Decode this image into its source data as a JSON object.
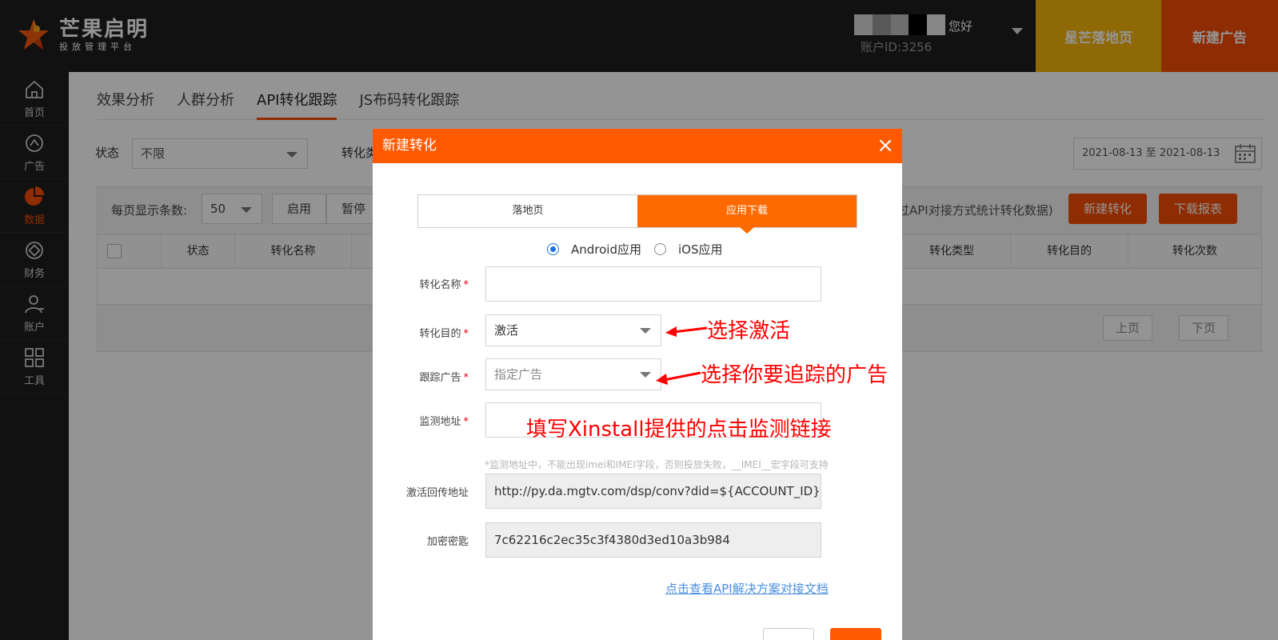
{
  "header": {
    "logo_title": "芒果启明",
    "logo_subtitle": "投放管理平台",
    "greeting": "您好",
    "account_id": "账户ID:3256",
    "btn_landing": "星芒落地页",
    "btn_new_ad": "新建广告"
  },
  "sidebar": {
    "items": [
      {
        "label": "首页",
        "icon": "home-icon"
      },
      {
        "label": "广告",
        "icon": "ad-icon"
      },
      {
        "label": "数据",
        "icon": "pie-chart-icon",
        "active": true
      },
      {
        "label": "财务",
        "icon": "finance-icon"
      },
      {
        "label": "账户",
        "icon": "user-icon"
      },
      {
        "label": "工具",
        "icon": "grid-icon"
      }
    ]
  },
  "main": {
    "tabs": [
      "效果分析",
      "人群分析",
      "API转化跟踪",
      "JS布码转化跟踪"
    ],
    "active_tab": "API转化跟踪",
    "filters": {
      "status_label": "状态",
      "status_value": "不限",
      "type_label": "转化类"
    },
    "date_range": "2021-08-13 至 2021-08-13",
    "toolbar": {
      "per_page_label": "每页显示条数:",
      "per_page_value": "50",
      "enable": "启用",
      "pause": "暂停",
      "hint": "过API对接方式统计转化数据)",
      "new_conversion": "新建转化",
      "download_report": "下载报表"
    },
    "table": {
      "columns": [
        "状态",
        "转化名称",
        "转化类型",
        "转化目的",
        "转化次数"
      ]
    },
    "pager": {
      "prev": "上页",
      "next": "下页"
    }
  },
  "modal": {
    "title": "新建转化",
    "close": "×",
    "segments": [
      "落地页",
      "应用下载"
    ],
    "selected_segment": "应用下载",
    "radio_android": "Android应用",
    "radio_ios": "iOS应用",
    "name_label": "转化名称",
    "purpose_label": "转化目的",
    "purpose_value": "激活",
    "track_ad_label": "跟踪广告",
    "track_ad_placeholder": "指定广告",
    "monitor_label": "监测地址",
    "monitor_hint": "*监测地址中，不能出现imei和IMEI字段，否则投放失败，__IMEI__宏字段可支持",
    "callback_label": "激活回传地址",
    "callback_value": "http://py.da.mgtv.com/dsp/conv?did=${ACCOUNT_ID}&idfa",
    "key_label": "加密密匙",
    "key_value": "7c62216c2ec35c3f4380d3ed10a3b984",
    "doc_link": "点击查看API解决方案对接文档",
    "required_mark": "*"
  },
  "annotations": {
    "select_activate": "选择激活",
    "select_ad": "选择你要追踪的广告",
    "fill_monitor": "填写Xinstall提供的点击监测链接"
  },
  "colors": {
    "brand_orange": "#ff5a00",
    "yellow": "#f6b60b",
    "annotation_red": "#ff0000",
    "link_blue": "#4a90e2"
  }
}
